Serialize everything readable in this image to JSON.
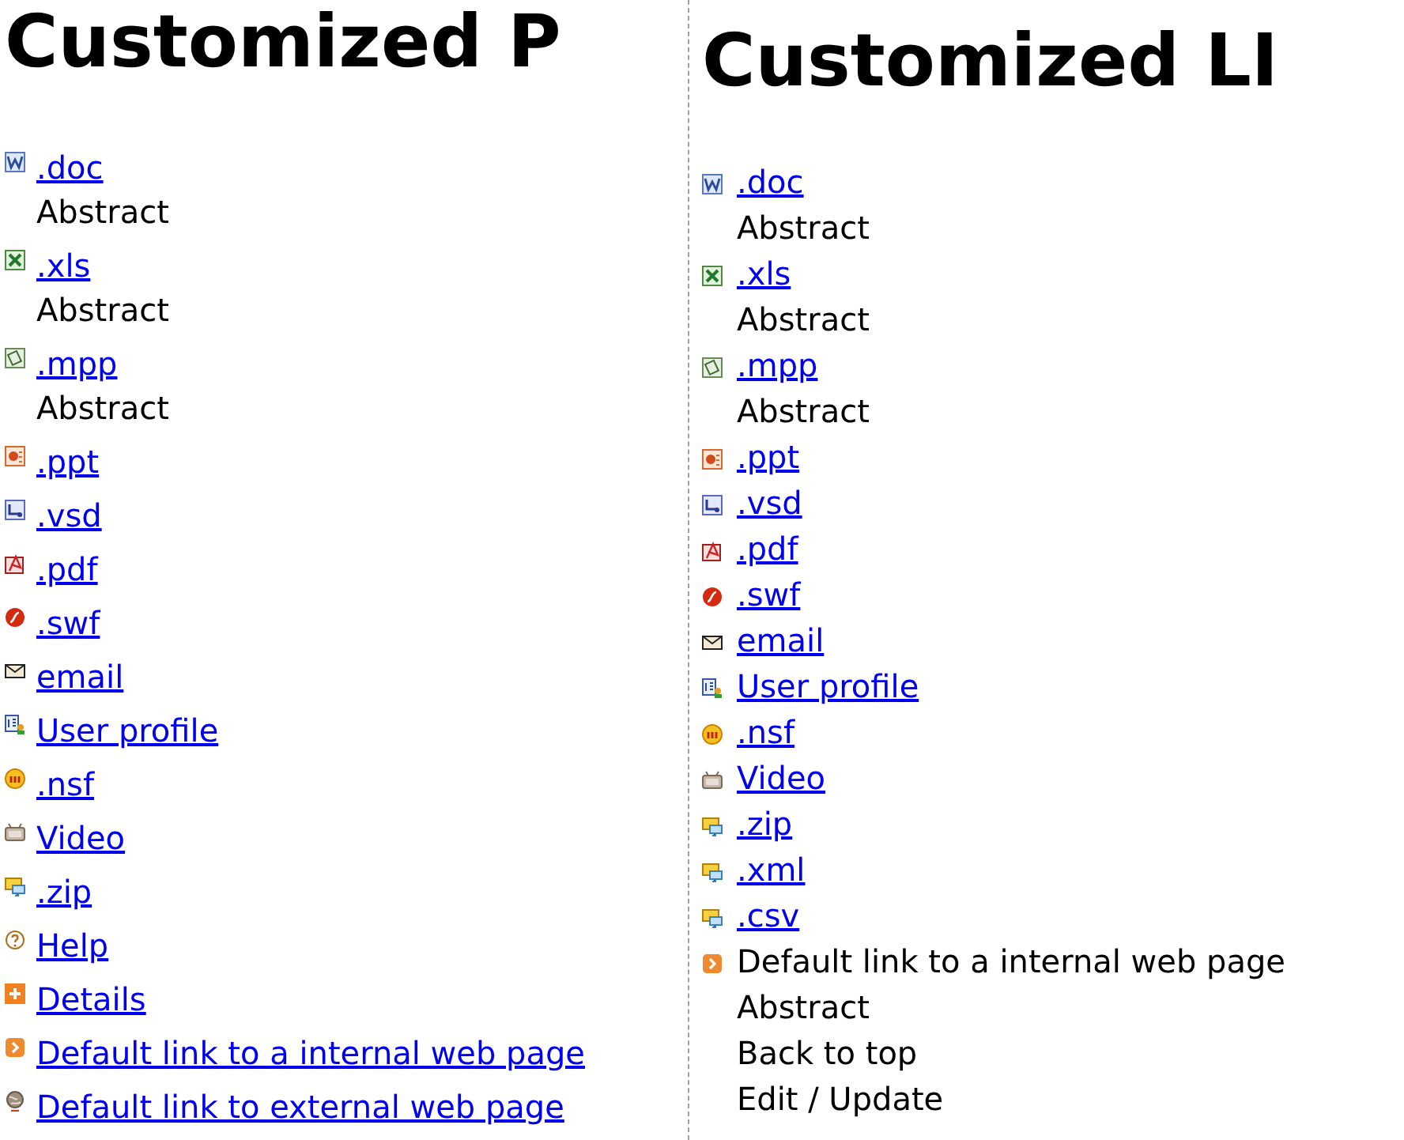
{
  "columns": [
    {
      "title": "Customized P",
      "items": [
        {
          "kind": "doc",
          "label": ".doc"
        },
        {
          "kind": "text",
          "label": "Abstract"
        },
        {
          "kind": "xls",
          "label": ".xls"
        },
        {
          "kind": "text",
          "label": "Abstract"
        },
        {
          "kind": "mpp",
          "label": ".mpp"
        },
        {
          "kind": "text",
          "label": "Abstract"
        },
        {
          "kind": "ppt",
          "label": ".ppt"
        },
        {
          "kind": "vsd",
          "label": ".vsd"
        },
        {
          "kind": "pdf",
          "label": ".pdf"
        },
        {
          "kind": "swf",
          "label": ".swf"
        },
        {
          "kind": "email",
          "label": "email"
        },
        {
          "kind": "user",
          "label": "User profile"
        },
        {
          "kind": "nsf",
          "label": ".nsf"
        },
        {
          "kind": "video",
          "label": "Video"
        },
        {
          "kind": "zip",
          "label": ".zip"
        },
        {
          "kind": "help",
          "label": "Help"
        },
        {
          "kind": "details",
          "label": "Details"
        },
        {
          "kind": "internal",
          "label": "Default link to a internal web page"
        },
        {
          "kind": "external",
          "label": "Default link to external web page"
        }
      ]
    },
    {
      "title": "Customized LI",
      "items": [
        {
          "kind": "doc",
          "label": ".doc"
        },
        {
          "kind": "text",
          "label": "Abstract"
        },
        {
          "kind": "xls",
          "label": ".xls"
        },
        {
          "kind": "text",
          "label": "Abstract"
        },
        {
          "kind": "mpp",
          "label": ".mpp"
        },
        {
          "kind": "text",
          "label": "Abstract"
        },
        {
          "kind": "ppt",
          "label": ".ppt"
        },
        {
          "kind": "vsd",
          "label": ".vsd"
        },
        {
          "kind": "pdf",
          "label": ".pdf"
        },
        {
          "kind": "swf",
          "label": ".swf"
        },
        {
          "kind": "email",
          "label": "email"
        },
        {
          "kind": "user",
          "label": "User profile"
        },
        {
          "kind": "nsf",
          "label": ".nsf"
        },
        {
          "kind": "video",
          "label": "Video"
        },
        {
          "kind": "zip",
          "label": ".zip"
        },
        {
          "kind": "zip",
          "label": ".xml"
        },
        {
          "kind": "zip",
          "label": ".csv"
        },
        {
          "kind": "title",
          "label": "Default link to a internal web page"
        },
        {
          "kind": "text",
          "label": "Abstract"
        },
        {
          "kind": "text",
          "label": "Back to top"
        },
        {
          "kind": "text",
          "label": "Edit / Update"
        }
      ]
    }
  ]
}
